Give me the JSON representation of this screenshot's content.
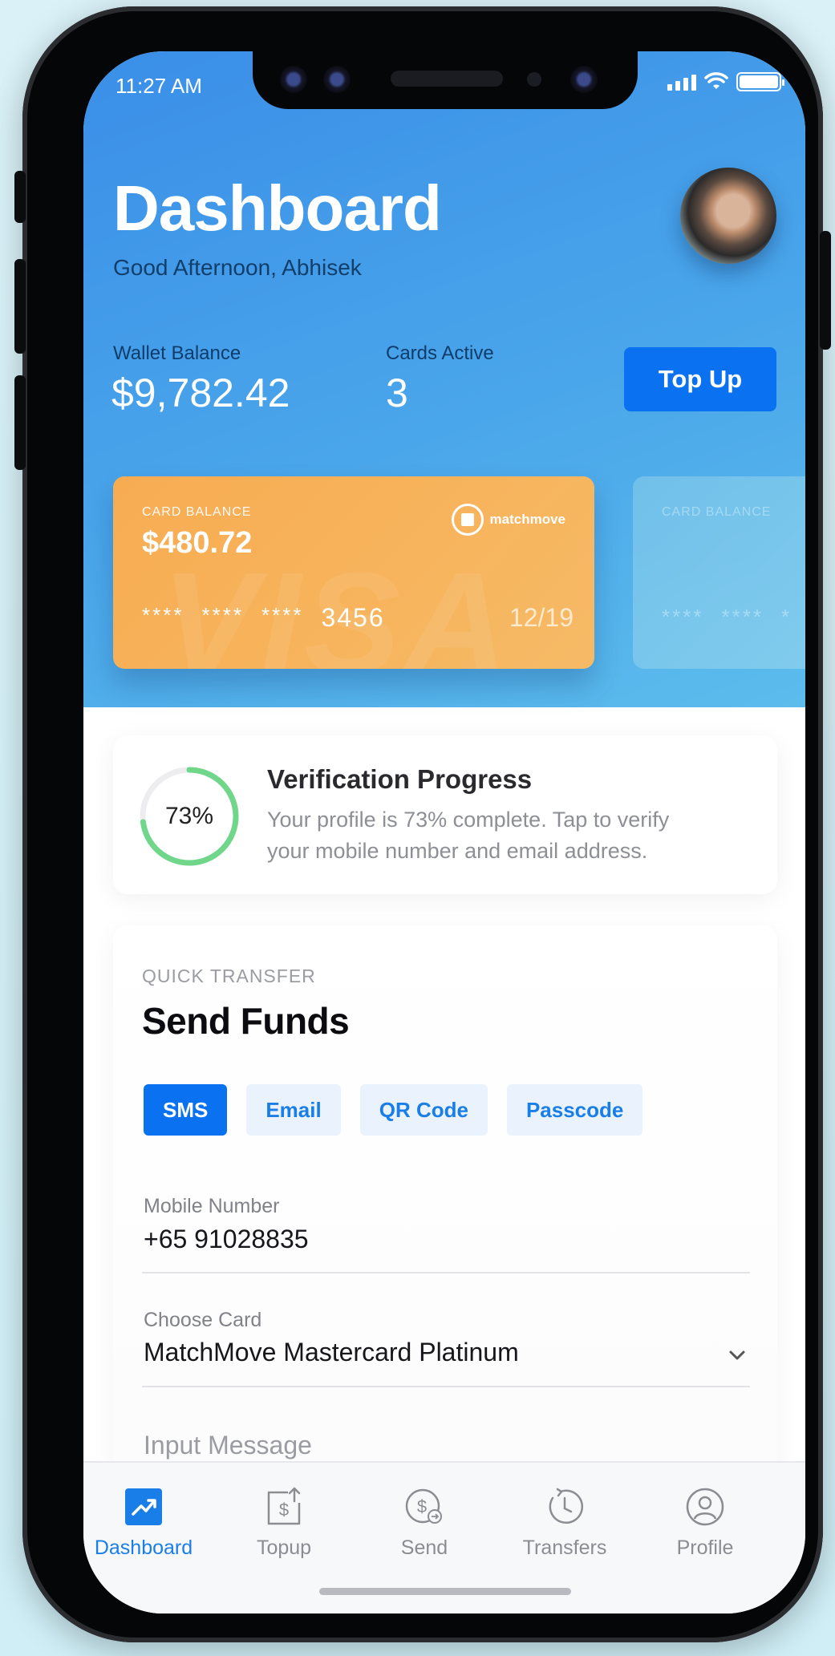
{
  "status_bar": {
    "time": "11:27 AM"
  },
  "header": {
    "title": "Dashboard",
    "greeting": "Good Afternoon, Abhisek",
    "wallet_balance_label": "Wallet Balance",
    "wallet_balance_value": "$9,782.42",
    "cards_active_label": "Cards Active",
    "cards_active_value": "3",
    "topup_button": "Top Up"
  },
  "cards": [
    {
      "label": "CARD BALANCE",
      "balance": "$480.72",
      "number_masked": [
        "****",
        "****",
        "****"
      ],
      "number_last4": "3456",
      "expiry": "12/19",
      "brand_text": "matchmove",
      "watermark": "VISA",
      "color": "#f7b05a"
    },
    {
      "label": "CARD BALANCE",
      "number_masked": [
        "****",
        "****",
        "*"
      ],
      "color": "#7cc7ea"
    }
  ],
  "verification": {
    "percent_text": "73%",
    "progress": 0.73,
    "title": "Verification Progress",
    "description": "Your profile is 73% complete. Tap to verify your mobile number and email address.",
    "ring_color": "#6fd68a"
  },
  "send_funds": {
    "eyebrow": "QUICK TRANSFER",
    "title": "Send Funds",
    "tabs": [
      {
        "label": "SMS",
        "active": true
      },
      {
        "label": "Email",
        "active": false
      },
      {
        "label": "QR Code",
        "active": false
      },
      {
        "label": "Passcode",
        "active": false
      }
    ],
    "mobile_label": "Mobile Number",
    "mobile_value": "+65 91028835",
    "card_label": "Choose Card",
    "card_value": "MatchMove Mastercard Platinum",
    "message_placeholder": "Input Message"
  },
  "tabbar": {
    "items": [
      {
        "label": "Dashboard",
        "icon": "trend-up-icon",
        "active": true
      },
      {
        "label": "Topup",
        "icon": "topup-icon",
        "active": false
      },
      {
        "label": "Send",
        "icon": "send-money-icon",
        "active": false
      },
      {
        "label": "Transfers",
        "icon": "history-icon",
        "active": false
      },
      {
        "label": "Profile",
        "icon": "user-icon",
        "active": false
      }
    ]
  },
  "colors": {
    "accent": "#0a72f0",
    "header_start": "#3a8ee8",
    "header_end": "#5cbcec",
    "card_orange": "#f7b05a"
  }
}
